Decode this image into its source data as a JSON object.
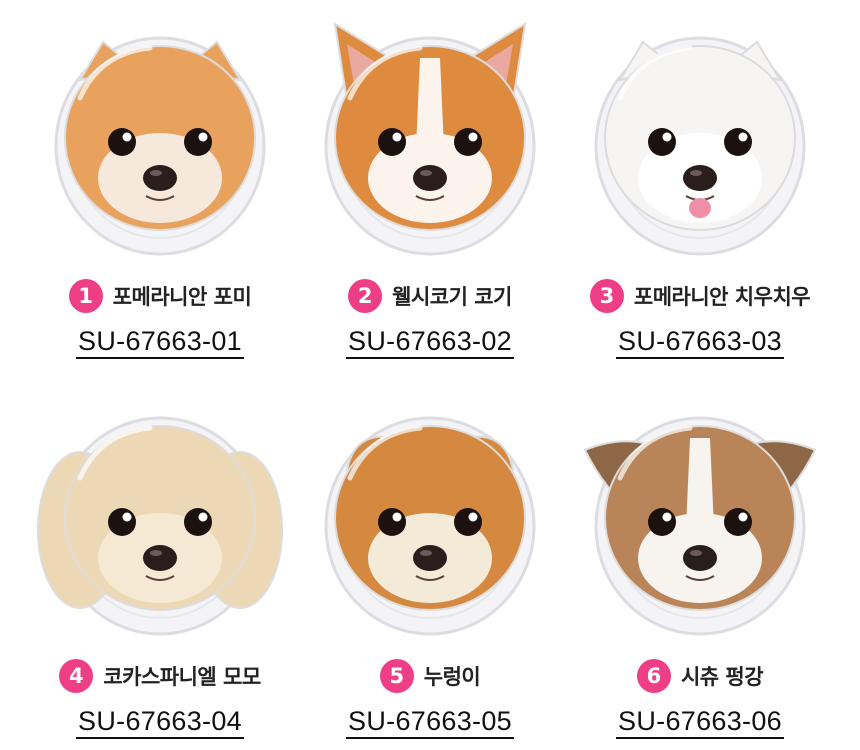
{
  "products": [
    {
      "number": "1",
      "name": "포메라니안 포미",
      "code": "SU-67663-01",
      "fur": "#e8a25e",
      "fur2": "#f6e9dc",
      "ears": "pointy-small",
      "icon": "pomeranian-face"
    },
    {
      "number": "2",
      "name": "웰시코기 코기",
      "code": "SU-67663-02",
      "fur": "#df8b3f",
      "fur2": "#fbf3ec",
      "ears": "pointy-big",
      "icon": "corgi-face"
    },
    {
      "number": "3",
      "name": "포메라니안 치우치우",
      "code": "SU-67663-03",
      "fur": "#f6f5f4",
      "fur2": "#ffffff",
      "ears": "pointy-small",
      "icon": "white-pomeranian-face"
    },
    {
      "number": "4",
      "name": "코카스파니엘 모모",
      "code": "SU-67663-04",
      "fur": "#edd8b6",
      "fur2": "#f5e9d3",
      "ears": "long",
      "icon": "cocker-spaniel-face"
    },
    {
      "number": "5",
      "name": "누렁이",
      "code": "SU-67663-05",
      "fur": "#d48840",
      "fur2": "#f4ead8",
      "ears": "folded",
      "icon": "shiba-puppy-face"
    },
    {
      "number": "6",
      "name": "시츄 펑강",
      "code": "SU-67663-06",
      "fur": "#b98558",
      "fur2": "#f7f3ee",
      "ears": "side",
      "icon": "shih-tzu-face"
    }
  ],
  "colors": {
    "badge": "#ee3f86",
    "ring": "#dcdde2"
  }
}
